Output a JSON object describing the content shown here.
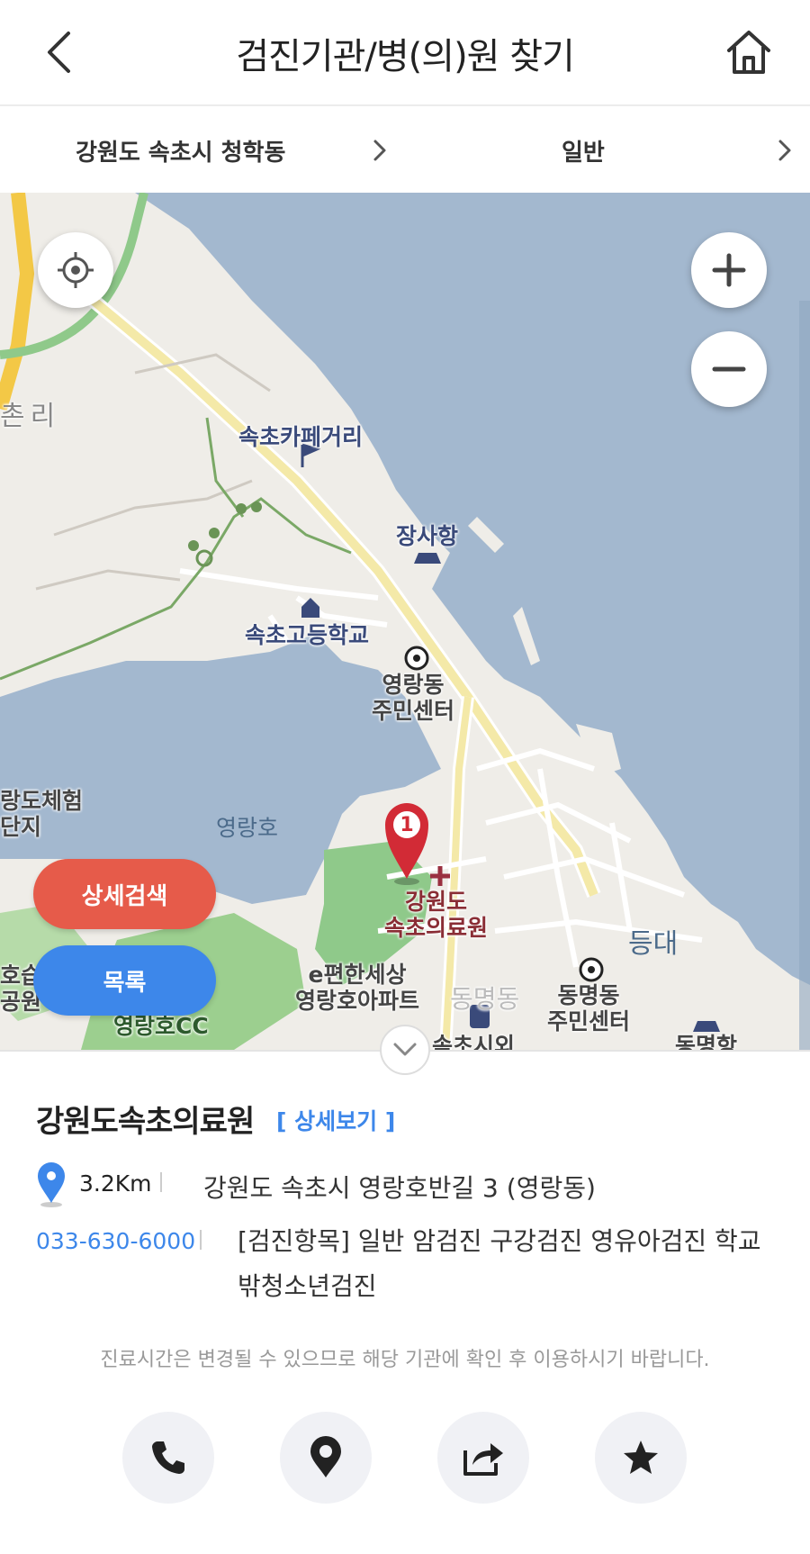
{
  "header": {
    "title": "검진기관/병(의)원 찾기",
    "back_icon": "chevron-left-icon",
    "home_icon": "home-icon"
  },
  "filters": {
    "region": "강원도 속초시 청학동",
    "type": "일반"
  },
  "map": {
    "labels": {
      "chon_ri": "촌리",
      "cafe_street": "속초카페거리",
      "jangsa_port": "장사항",
      "sokcho_high": "속초고등학교",
      "yeongnang_center": "영랑동\n주민센터",
      "yeongnang_lake": "영랑호",
      "experience": "랑도체험\n단지",
      "hospital": "강원도\n속초의료원",
      "e_apt": "e편한세상\n영랑호아파트",
      "dongmyeong_center": "동명동\n주민센터",
      "dungdae": "등대",
      "dongmyeong_dong": "동명동",
      "cc": "영랑호CC",
      "seupji": "호습\n공원",
      "dongmyeong_port": "동명항",
      "sokcho_market": "속초시외"
    },
    "marker_number": "1",
    "detail_search": "상세검색",
    "list": "목록"
  },
  "info": {
    "name": "강원도속초의료원",
    "detail_link": "[ 상세보기 ]",
    "distance": "3.2Km",
    "address": "강원도 속초시 영랑호반길 3 (영랑동)",
    "phone": "033-630-6000",
    "items": "[검진항목] 일반 암검진 구강검진 영유아검진 학교밖청소년검진",
    "notice": "진료시간은 변경될 수 있으므로 해당 기관에 확인 후 이용하시기 바랍니다."
  },
  "colors": {
    "accent_blue": "#3d87ea",
    "accent_red": "#e65b4a",
    "sea": "#a3b8cf",
    "land": "#efede8"
  }
}
